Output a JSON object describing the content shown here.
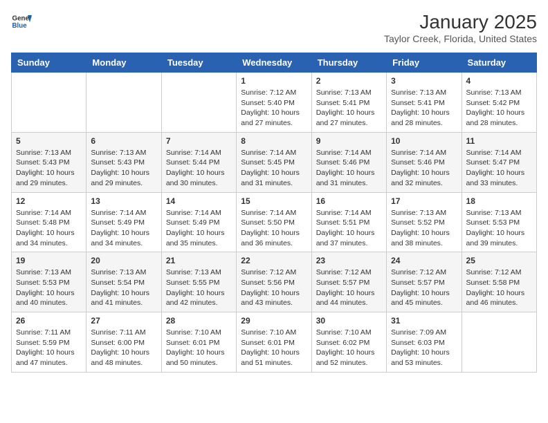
{
  "header": {
    "logo_line1": "General",
    "logo_line2": "Blue",
    "title": "January 2025",
    "subtitle": "Taylor Creek, Florida, United States"
  },
  "weekdays": [
    "Sunday",
    "Monday",
    "Tuesday",
    "Wednesday",
    "Thursday",
    "Friday",
    "Saturday"
  ],
  "weeks": [
    [
      {
        "day": "",
        "sunrise": "",
        "sunset": "",
        "daylight": ""
      },
      {
        "day": "",
        "sunrise": "",
        "sunset": "",
        "daylight": ""
      },
      {
        "day": "",
        "sunrise": "",
        "sunset": "",
        "daylight": ""
      },
      {
        "day": "1",
        "sunrise": "Sunrise: 7:12 AM",
        "sunset": "Sunset: 5:40 PM",
        "daylight": "Daylight: 10 hours and 27 minutes."
      },
      {
        "day": "2",
        "sunrise": "Sunrise: 7:13 AM",
        "sunset": "Sunset: 5:41 PM",
        "daylight": "Daylight: 10 hours and 27 minutes."
      },
      {
        "day": "3",
        "sunrise": "Sunrise: 7:13 AM",
        "sunset": "Sunset: 5:41 PM",
        "daylight": "Daylight: 10 hours and 28 minutes."
      },
      {
        "day": "4",
        "sunrise": "Sunrise: 7:13 AM",
        "sunset": "Sunset: 5:42 PM",
        "daylight": "Daylight: 10 hours and 28 minutes."
      }
    ],
    [
      {
        "day": "5",
        "sunrise": "Sunrise: 7:13 AM",
        "sunset": "Sunset: 5:43 PM",
        "daylight": "Daylight: 10 hours and 29 minutes."
      },
      {
        "day": "6",
        "sunrise": "Sunrise: 7:13 AM",
        "sunset": "Sunset: 5:43 PM",
        "daylight": "Daylight: 10 hours and 29 minutes."
      },
      {
        "day": "7",
        "sunrise": "Sunrise: 7:14 AM",
        "sunset": "Sunset: 5:44 PM",
        "daylight": "Daylight: 10 hours and 30 minutes."
      },
      {
        "day": "8",
        "sunrise": "Sunrise: 7:14 AM",
        "sunset": "Sunset: 5:45 PM",
        "daylight": "Daylight: 10 hours and 31 minutes."
      },
      {
        "day": "9",
        "sunrise": "Sunrise: 7:14 AM",
        "sunset": "Sunset: 5:46 PM",
        "daylight": "Daylight: 10 hours and 31 minutes."
      },
      {
        "day": "10",
        "sunrise": "Sunrise: 7:14 AM",
        "sunset": "Sunset: 5:46 PM",
        "daylight": "Daylight: 10 hours and 32 minutes."
      },
      {
        "day": "11",
        "sunrise": "Sunrise: 7:14 AM",
        "sunset": "Sunset: 5:47 PM",
        "daylight": "Daylight: 10 hours and 33 minutes."
      }
    ],
    [
      {
        "day": "12",
        "sunrise": "Sunrise: 7:14 AM",
        "sunset": "Sunset: 5:48 PM",
        "daylight": "Daylight: 10 hours and 34 minutes."
      },
      {
        "day": "13",
        "sunrise": "Sunrise: 7:14 AM",
        "sunset": "Sunset: 5:49 PM",
        "daylight": "Daylight: 10 hours and 34 minutes."
      },
      {
        "day": "14",
        "sunrise": "Sunrise: 7:14 AM",
        "sunset": "Sunset: 5:49 PM",
        "daylight": "Daylight: 10 hours and 35 minutes."
      },
      {
        "day": "15",
        "sunrise": "Sunrise: 7:14 AM",
        "sunset": "Sunset: 5:50 PM",
        "daylight": "Daylight: 10 hours and 36 minutes."
      },
      {
        "day": "16",
        "sunrise": "Sunrise: 7:14 AM",
        "sunset": "Sunset: 5:51 PM",
        "daylight": "Daylight: 10 hours and 37 minutes."
      },
      {
        "day": "17",
        "sunrise": "Sunrise: 7:13 AM",
        "sunset": "Sunset: 5:52 PM",
        "daylight": "Daylight: 10 hours and 38 minutes."
      },
      {
        "day": "18",
        "sunrise": "Sunrise: 7:13 AM",
        "sunset": "Sunset: 5:53 PM",
        "daylight": "Daylight: 10 hours and 39 minutes."
      }
    ],
    [
      {
        "day": "19",
        "sunrise": "Sunrise: 7:13 AM",
        "sunset": "Sunset: 5:53 PM",
        "daylight": "Daylight: 10 hours and 40 minutes."
      },
      {
        "day": "20",
        "sunrise": "Sunrise: 7:13 AM",
        "sunset": "Sunset: 5:54 PM",
        "daylight": "Daylight: 10 hours and 41 minutes."
      },
      {
        "day": "21",
        "sunrise": "Sunrise: 7:13 AM",
        "sunset": "Sunset: 5:55 PM",
        "daylight": "Daylight: 10 hours and 42 minutes."
      },
      {
        "day": "22",
        "sunrise": "Sunrise: 7:12 AM",
        "sunset": "Sunset: 5:56 PM",
        "daylight": "Daylight: 10 hours and 43 minutes."
      },
      {
        "day": "23",
        "sunrise": "Sunrise: 7:12 AM",
        "sunset": "Sunset: 5:57 PM",
        "daylight": "Daylight: 10 hours and 44 minutes."
      },
      {
        "day": "24",
        "sunrise": "Sunrise: 7:12 AM",
        "sunset": "Sunset: 5:57 PM",
        "daylight": "Daylight: 10 hours and 45 minutes."
      },
      {
        "day": "25",
        "sunrise": "Sunrise: 7:12 AM",
        "sunset": "Sunset: 5:58 PM",
        "daylight": "Daylight: 10 hours and 46 minutes."
      }
    ],
    [
      {
        "day": "26",
        "sunrise": "Sunrise: 7:11 AM",
        "sunset": "Sunset: 5:59 PM",
        "daylight": "Daylight: 10 hours and 47 minutes."
      },
      {
        "day": "27",
        "sunrise": "Sunrise: 7:11 AM",
        "sunset": "Sunset: 6:00 PM",
        "daylight": "Daylight: 10 hours and 48 minutes."
      },
      {
        "day": "28",
        "sunrise": "Sunrise: 7:10 AM",
        "sunset": "Sunset: 6:01 PM",
        "daylight": "Daylight: 10 hours and 50 minutes."
      },
      {
        "day": "29",
        "sunrise": "Sunrise: 7:10 AM",
        "sunset": "Sunset: 6:01 PM",
        "daylight": "Daylight: 10 hours and 51 minutes."
      },
      {
        "day": "30",
        "sunrise": "Sunrise: 7:10 AM",
        "sunset": "Sunset: 6:02 PM",
        "daylight": "Daylight: 10 hours and 52 minutes."
      },
      {
        "day": "31",
        "sunrise": "Sunrise: 7:09 AM",
        "sunset": "Sunset: 6:03 PM",
        "daylight": "Daylight: 10 hours and 53 minutes."
      },
      {
        "day": "",
        "sunrise": "",
        "sunset": "",
        "daylight": ""
      }
    ]
  ]
}
